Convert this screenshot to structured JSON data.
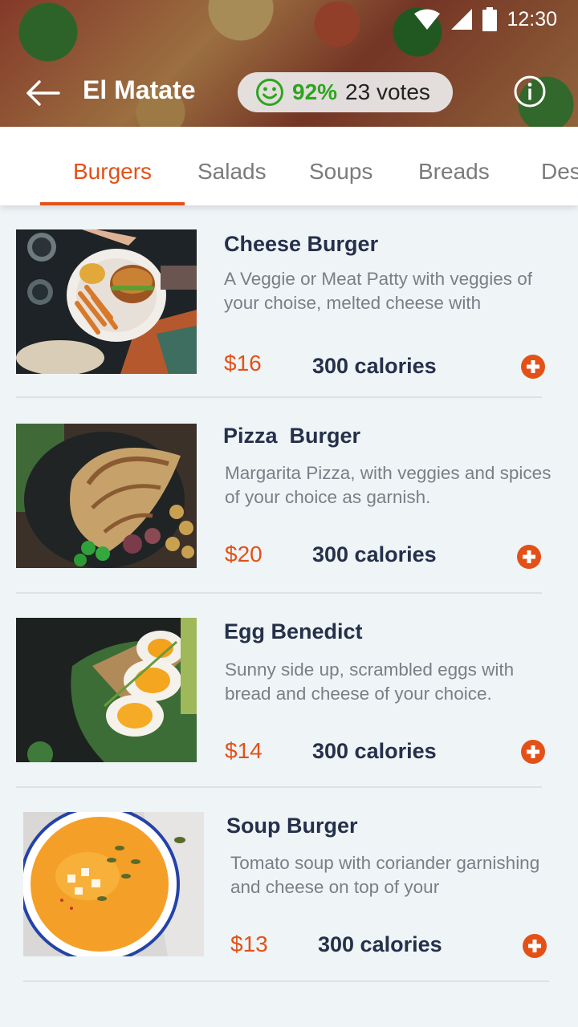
{
  "status": {
    "time": "12:30"
  },
  "header": {
    "title": "El Matate",
    "rating_percent": "92%",
    "rating_votes": "23 votes"
  },
  "tabs": [
    {
      "label": "Burgers",
      "active": true
    },
    {
      "label": "Salads"
    },
    {
      "label": "Soups"
    },
    {
      "label": "Breads"
    },
    {
      "label": "Des"
    }
  ],
  "menu": [
    {
      "name": "Cheese Burger",
      "description": "A Veggie or Meat Patty with veggies of your choise, melted cheese with",
      "price": "$16",
      "calories": "300 calories"
    },
    {
      "name": "Pizza  Burger",
      "description": "Margarita Pizza, with veggies and spices of your choice as garnish.",
      "price": "$20",
      "calories": "300 calories"
    },
    {
      "name": "Egg Benedict",
      "description": "Sunny side up, scrambled eggs with bread and cheese of your choice.",
      "price": "$14",
      "calories": "300 calories"
    },
    {
      "name": "Soup Burger",
      "description": "Tomato soup with coriander garnishing and cheese on top of your",
      "price": "$13",
      "calories": "300 calories"
    }
  ],
  "colors": {
    "accent": "#e35118",
    "rating_green": "#2ea41f",
    "text_dark": "#25304a"
  }
}
